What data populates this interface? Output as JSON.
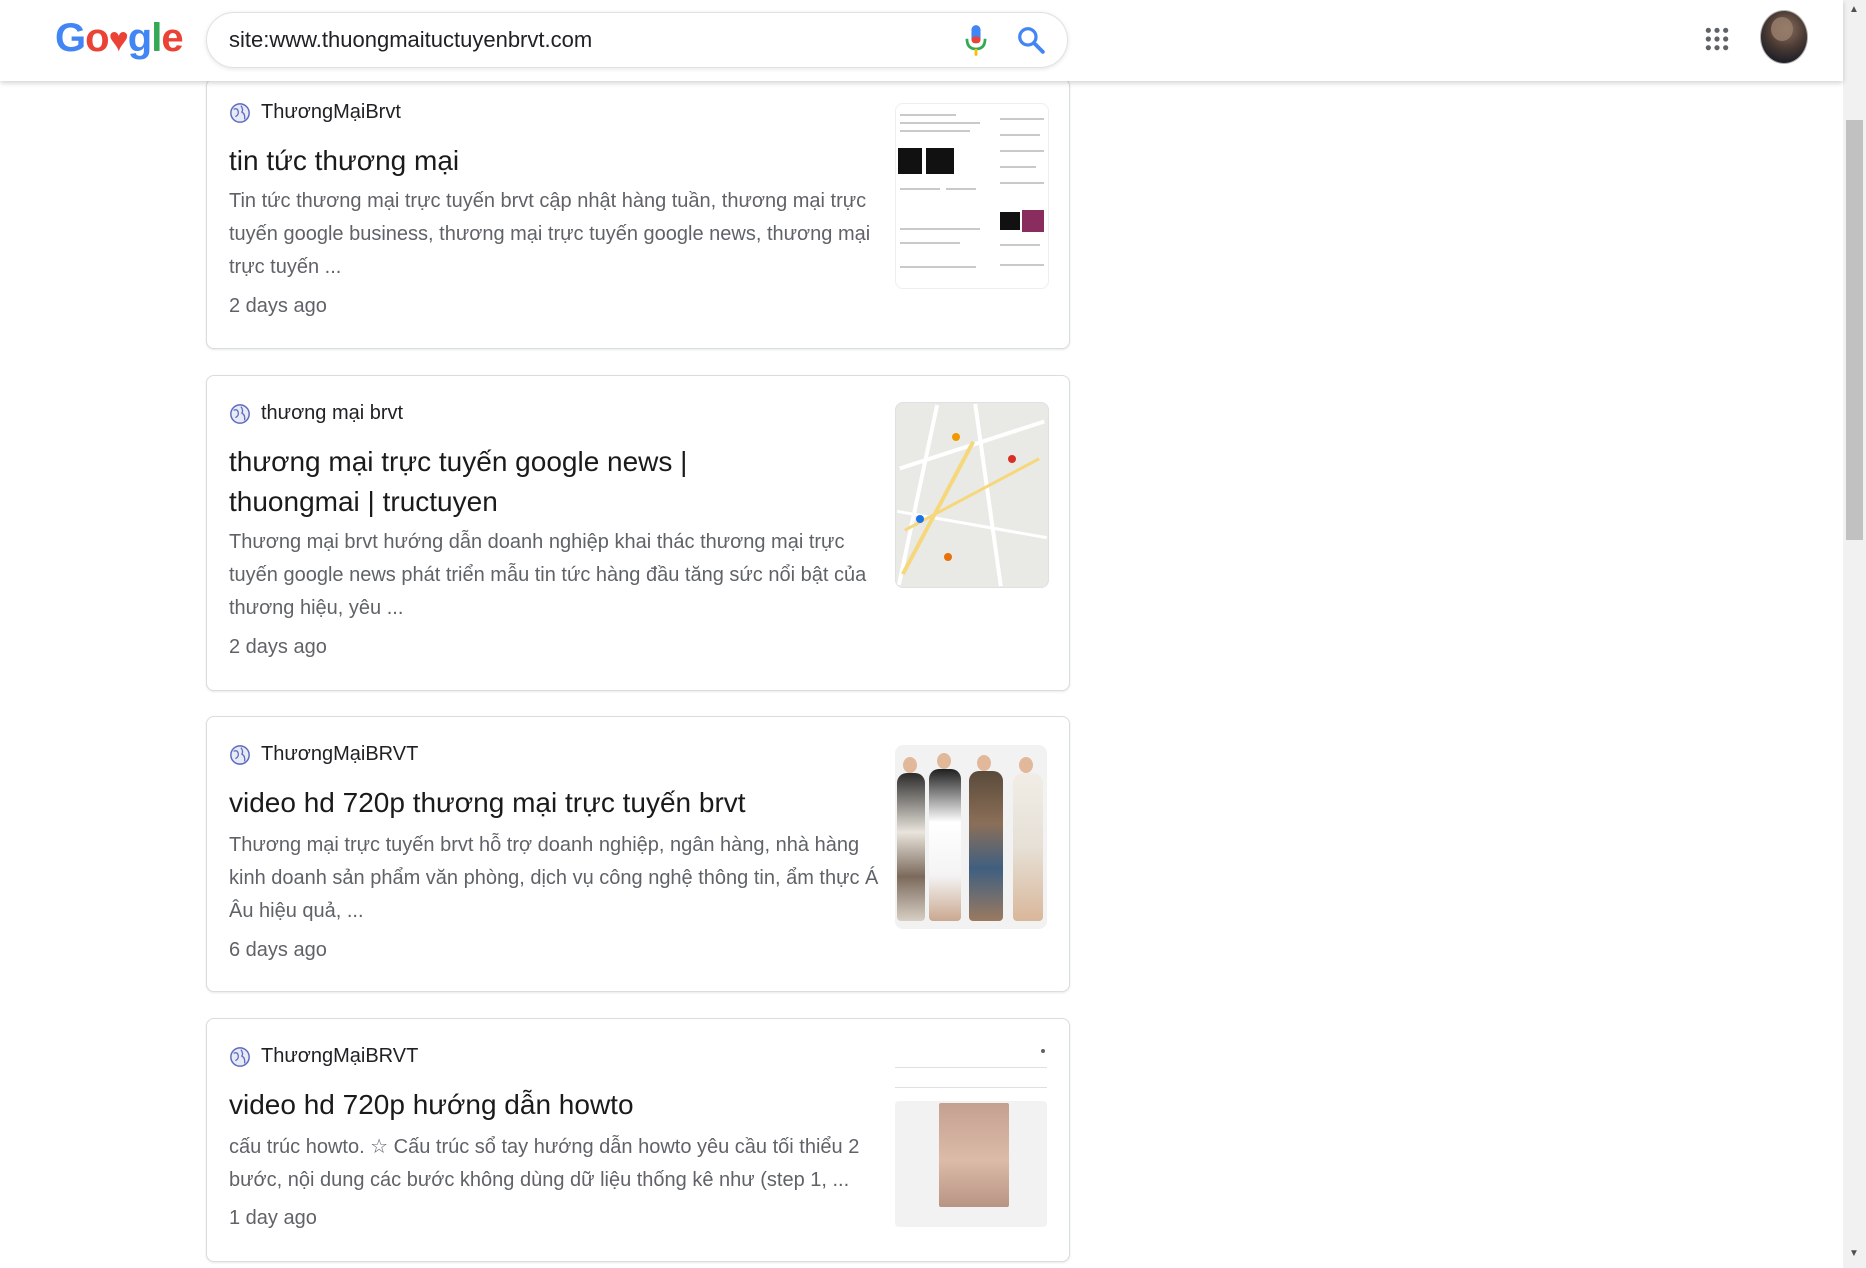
{
  "header": {
    "logo": {
      "g1": "G",
      "o1": "o",
      "heart": "♥",
      "g2": "g",
      "l": "l",
      "e": "e"
    },
    "search_value": "site:www.thuongmaituctuyenbrvt.com"
  },
  "results": [
    {
      "site": "ThươngMạiBrvt",
      "title": "tin tức thương mại",
      "snippet": "Tin tức thương mại trực tuyến brvt cập nhật hàng tuần, thương mại trực tuyến google business, thương mại trực tuyến google news, thương mại trực tuyến ...",
      "date": "2 days ago"
    },
    {
      "site": "thương mại brvt",
      "title": "thương mại trực tuyến google news | thuongmai | tructuyen",
      "snippet": "Thương mại brvt hướng dẫn doanh nghiệp khai thác thương mại trực tuyến google news phát triển mẫu tin tức hàng đầu tăng sức nổi bật của thương hiệu, yêu ...",
      "date": "2 days ago"
    },
    {
      "site": "ThươngMạiBRVT",
      "title": "video hd 720p thương mại trực tuyến brvt",
      "snippet": "Thương mại trực tuyến brvt hỗ trợ doanh nghiệp, ngân hàng, nhà hàng kinh doanh sản phẩm văn phòng, dịch vụ công nghệ thông tin, ẩm thực Á Âu hiệu quả, ...",
      "date": "6 days ago"
    },
    {
      "site": "ThươngMạiBRVT",
      "title": "video hd 720p hướng dẫn howto",
      "snippet": "cấu trúc howto. ☆ Cấu trúc sổ tay hướng dẫn howto yêu cầu tối thiểu 2 bước, nội dung các bước không dùng dữ liệu thống kê như (step 1, ...",
      "date": "1 day ago"
    }
  ],
  "icons": [
    "mic-icon",
    "search-icon",
    "apps-icon",
    "globe-icon"
  ],
  "colors": {
    "brand_blue": "#4285f4",
    "brand_red": "#ea4335",
    "brand_green": "#34a853",
    "text_secondary": "#5f6368"
  }
}
